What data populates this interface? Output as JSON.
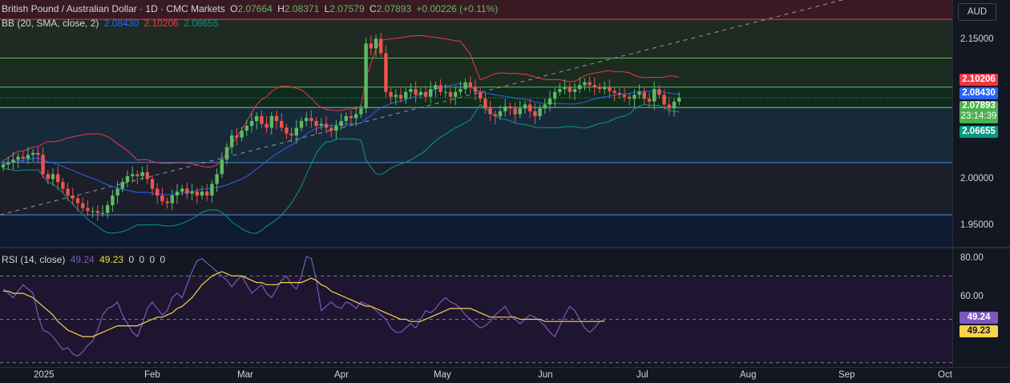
{
  "header": {
    "symbol": "British Pound / Australian Dollar · 1D · CMC Markets",
    "o_label": "O",
    "o_val": "2.07664",
    "h_label": "H",
    "h_val": "2.08371",
    "l_label": "L",
    "l_val": "2.07579",
    "c_label": "C",
    "c_val": "2.07893",
    "chg": "+0.00226 (+0.11%)",
    "bb_label": "BB (20, SMA, close, 2)",
    "bb_mid": "2.08430",
    "bb_up": "2.10206",
    "bb_low": "2.06655",
    "rsi_label": "RSI (14, close)",
    "rsi_val": "49.24",
    "rsi_ma": "49.23",
    "zeros": [
      "0",
      "0",
      "0",
      "0"
    ]
  },
  "currency": "AUD",
  "price_tags": {
    "upper": "2.10206",
    "middle": "2.08430",
    "last": "2.07893",
    "countdown": "23:14:39",
    "lower": "2.06655"
  },
  "rsi_tags": {
    "rsi": "49.24",
    "ma": "49.23"
  },
  "colors": {
    "up": "#26a69a",
    "up_body": "#5dbb63",
    "down": "#ef5350",
    "bb_mid": "#2962ff",
    "bb_upper": "#f23645",
    "bb_lower": "#089981",
    "rsi": "#7e57c2",
    "rsi_ma": "#f7d34a",
    "last_price": "#4caf50"
  },
  "chart_data": [
    {
      "type": "candlestick",
      "title": "British Pound / Australian Dollar · 1D · CMC Markets",
      "x_ticks": [
        "2025",
        "Feb",
        "Mar",
        "Apr",
        "May",
        "Jun",
        "Jul",
        "Aug",
        "Sep",
        "Oct"
      ],
      "y_ticks": [
        "2.15000",
        "2.00000",
        "1.95000"
      ],
      "ylim": [
        1.925,
        2.18
      ],
      "ohlc_close_approx": [
        2.01,
        2.012,
        2.015,
        2.018,
        2.016,
        2.02,
        2.022,
        2.02,
        2.0,
        1.995,
        2.0,
        1.992,
        1.985,
        1.978,
        1.975,
        1.97,
        1.965,
        1.962,
        1.962,
        1.96,
        1.96,
        1.968,
        1.978,
        1.985,
        1.992,
        1.998,
        2.0,
        1.998,
        2.002,
        1.995,
        1.985,
        1.978,
        1.972,
        1.97,
        1.978,
        1.982,
        1.985,
        1.98,
        1.982,
        1.978,
        1.982,
        1.978,
        1.99,
        2.0,
        2.015,
        2.028,
        2.04,
        2.038,
        2.045,
        2.05,
        2.055,
        2.06,
        2.052,
        2.048,
        2.06,
        2.055,
        2.048,
        2.042,
        2.04,
        2.048,
        2.055,
        2.058,
        2.055,
        2.05,
        2.052,
        2.048,
        2.045,
        2.05,
        2.055,
        2.06,
        2.058,
        2.062,
        2.068,
        2.135,
        2.13,
        2.14,
        2.125,
        2.085,
        2.08,
        2.082,
        2.078,
        2.085,
        2.088,
        2.082,
        2.085,
        2.08,
        2.088,
        2.092,
        2.085,
        2.085,
        2.08,
        2.085,
        2.088,
        2.095,
        2.09,
        2.085,
        2.078,
        2.068,
        2.062,
        2.06,
        2.065,
        2.07,
        2.068,
        2.062,
        2.068,
        2.072,
        2.065,
        2.06,
        2.068,
        2.072,
        2.078,
        2.085,
        2.088,
        2.09,
        2.085,
        2.088,
        2.092,
        2.095,
        2.092,
        2.09,
        2.088,
        2.09,
        2.086,
        2.084,
        2.082,
        2.08,
        2.078,
        2.082,
        2.085,
        2.078,
        2.075,
        2.088,
        2.082,
        2.072,
        2.068,
        2.075,
        2.079
      ],
      "bollinger": {
        "period": 20,
        "mult": 2,
        "upper_last": 2.10206,
        "middle_last": 2.0843,
        "lower_last": 2.06655
      },
      "horizontal_levels": [
        2.16,
        2.12,
        2.09,
        2.069,
        2.012,
        1.958
      ],
      "last_price": 2.07893
    },
    {
      "type": "line",
      "title": "RSI (14, close)",
      "y_ticks": [
        "80.00",
        "60.00"
      ],
      "ylim": [
        28,
        82
      ],
      "levels": [
        70,
        50,
        30
      ],
      "series": [
        {
          "name": "RSI",
          "values": [
            64,
            62,
            60,
            63,
            66,
            64,
            62,
            52,
            45,
            44,
            42,
            39,
            36,
            37,
            34,
            33,
            35,
            38,
            40,
            45,
            52,
            55,
            56,
            58,
            52,
            48,
            44,
            42,
            48,
            55,
            58,
            55,
            52,
            54,
            60,
            62,
            60,
            66,
            72,
            77,
            78,
            76,
            74,
            72,
            70,
            68,
            65,
            68,
            70,
            66,
            62,
            64,
            66,
            62,
            60,
            64,
            68,
            70,
            66,
            64,
            70,
            79,
            78,
            68,
            54,
            56,
            58,
            56,
            55,
            58,
            57,
            55,
            58,
            57,
            56,
            54,
            52,
            50,
            46,
            44,
            44,
            46,
            48,
            46,
            50,
            54,
            53,
            55,
            58,
            60,
            58,
            57,
            55,
            52,
            50,
            48,
            46,
            47,
            49,
            52,
            54,
            56,
            52,
            50,
            48,
            50,
            52,
            51,
            49,
            47,
            44,
            42,
            47,
            52,
            56,
            54,
            50,
            46,
            44,
            46,
            49,
            49.24
          ]
        },
        {
          "name": "RSI-MA",
          "values": [
            63,
            63,
            62,
            62,
            62,
            61,
            60,
            58,
            56,
            54,
            52,
            49,
            47,
            45,
            44,
            43,
            42,
            42,
            42,
            43,
            44,
            45,
            46,
            47,
            47,
            47,
            47,
            47,
            48,
            49,
            50,
            51,
            51,
            52,
            53,
            55,
            56,
            58,
            60,
            63,
            66,
            68,
            70,
            71,
            72,
            71,
            70,
            70,
            70,
            69,
            68,
            67,
            67,
            66,
            66,
            66,
            67,
            67,
            67,
            67,
            67,
            68,
            69,
            68,
            66,
            65,
            63,
            62,
            61,
            60,
            59,
            58,
            57,
            56,
            56,
            55,
            54,
            53,
            52,
            51,
            50,
            50,
            49,
            49,
            49,
            50,
            51,
            52,
            53,
            54,
            55,
            55,
            55,
            55,
            55,
            54,
            53,
            52,
            51,
            51,
            51,
            51,
            51,
            51,
            50,
            50,
            50,
            50,
            50,
            49,
            49,
            49,
            49,
            49,
            49,
            49,
            49,
            49,
            49,
            49,
            49,
            49.23
          ]
        }
      ]
    }
  ]
}
